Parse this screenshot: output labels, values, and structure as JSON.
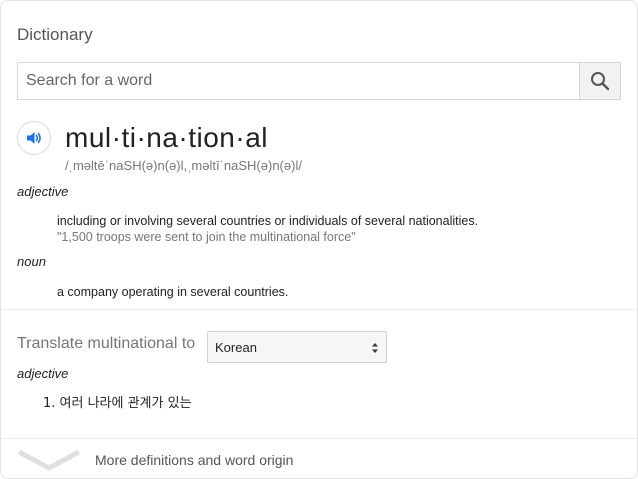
{
  "header": {
    "title": "Dictionary"
  },
  "search": {
    "placeholder": "Search for a word"
  },
  "entry": {
    "word": "mul·ti·na·tion·al",
    "phonetic": "/ˌməltēˈnaSH(ə)n(ə)l,ˌməltīˈnaSH(ə)n(ə)l/",
    "senses": [
      {
        "pos": "adjective",
        "definition": "including or involving several countries or individuals of several nationalities.",
        "example": "\"1,500 troops were sent to join the multinational force\""
      },
      {
        "pos": "noun",
        "definition": "a company operating in several countries."
      }
    ]
  },
  "translate": {
    "label": "Translate multinational to",
    "language": "Korean",
    "pos": "adjective",
    "items": [
      "1. 여러 나라에 관계가 있는"
    ]
  },
  "footer": {
    "more_label": "More definitions and word origin"
  },
  "colors": {
    "speaker_blue": "#1a73e8",
    "muted": "#777777",
    "divider": "#ebebeb"
  }
}
